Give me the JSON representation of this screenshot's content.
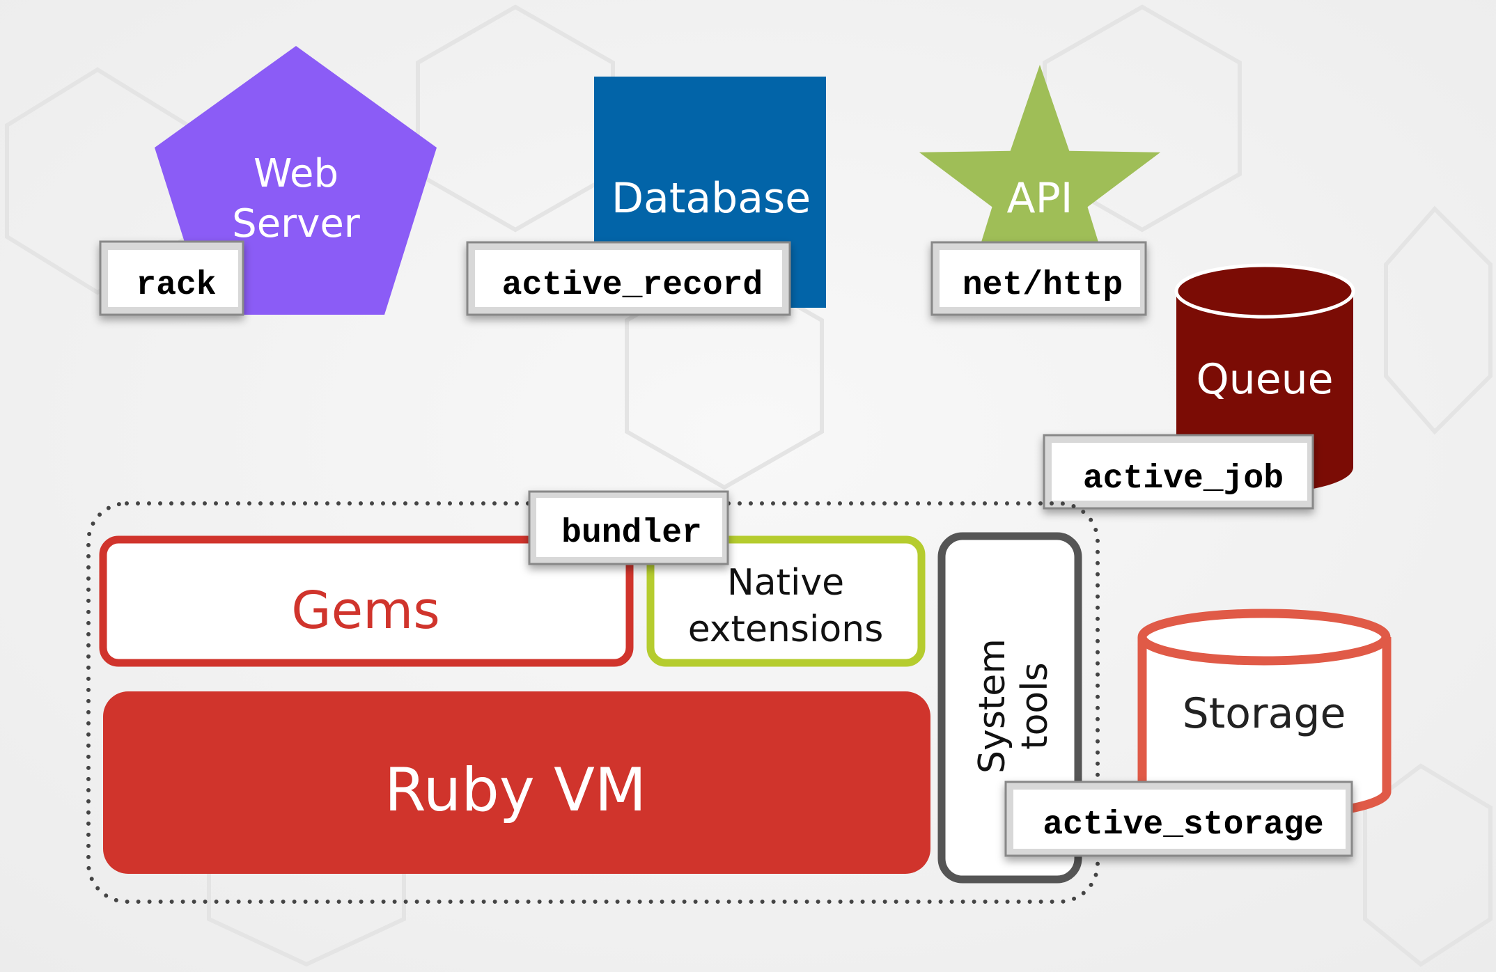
{
  "colors": {
    "web_server": "#8B5CF6",
    "database": "#0264A8",
    "api": "#9FBE57",
    "queue": "#7B0C05",
    "gems": "#D0342C",
    "native_extensions": "#B5CC2E",
    "ruby_vm": "#D0342C",
    "system_tools": "#555555",
    "storage": "#E05A47"
  },
  "nodes": {
    "web_server": {
      "line1": "Web",
      "line2": "Server",
      "shape": "pentagon"
    },
    "database": {
      "label": "Database",
      "shape": "square"
    },
    "api": {
      "label": "API",
      "shape": "star"
    },
    "queue": {
      "label": "Queue",
      "shape": "cylinder"
    },
    "gems": {
      "label": "Gems"
    },
    "native_extensions": {
      "line1": "Native",
      "line2": "extensions"
    },
    "ruby_vm": {
      "label": "Ruby VM"
    },
    "system_tools": {
      "line1": "System",
      "line2": "tools"
    },
    "storage": {
      "label": "Storage",
      "shape": "cylinder"
    }
  },
  "tags": {
    "rack": "rack",
    "active_record": "active_record",
    "net_http": "net/http",
    "active_job": "active_job",
    "bundler": "bundler",
    "active_storage": "active_storage"
  }
}
